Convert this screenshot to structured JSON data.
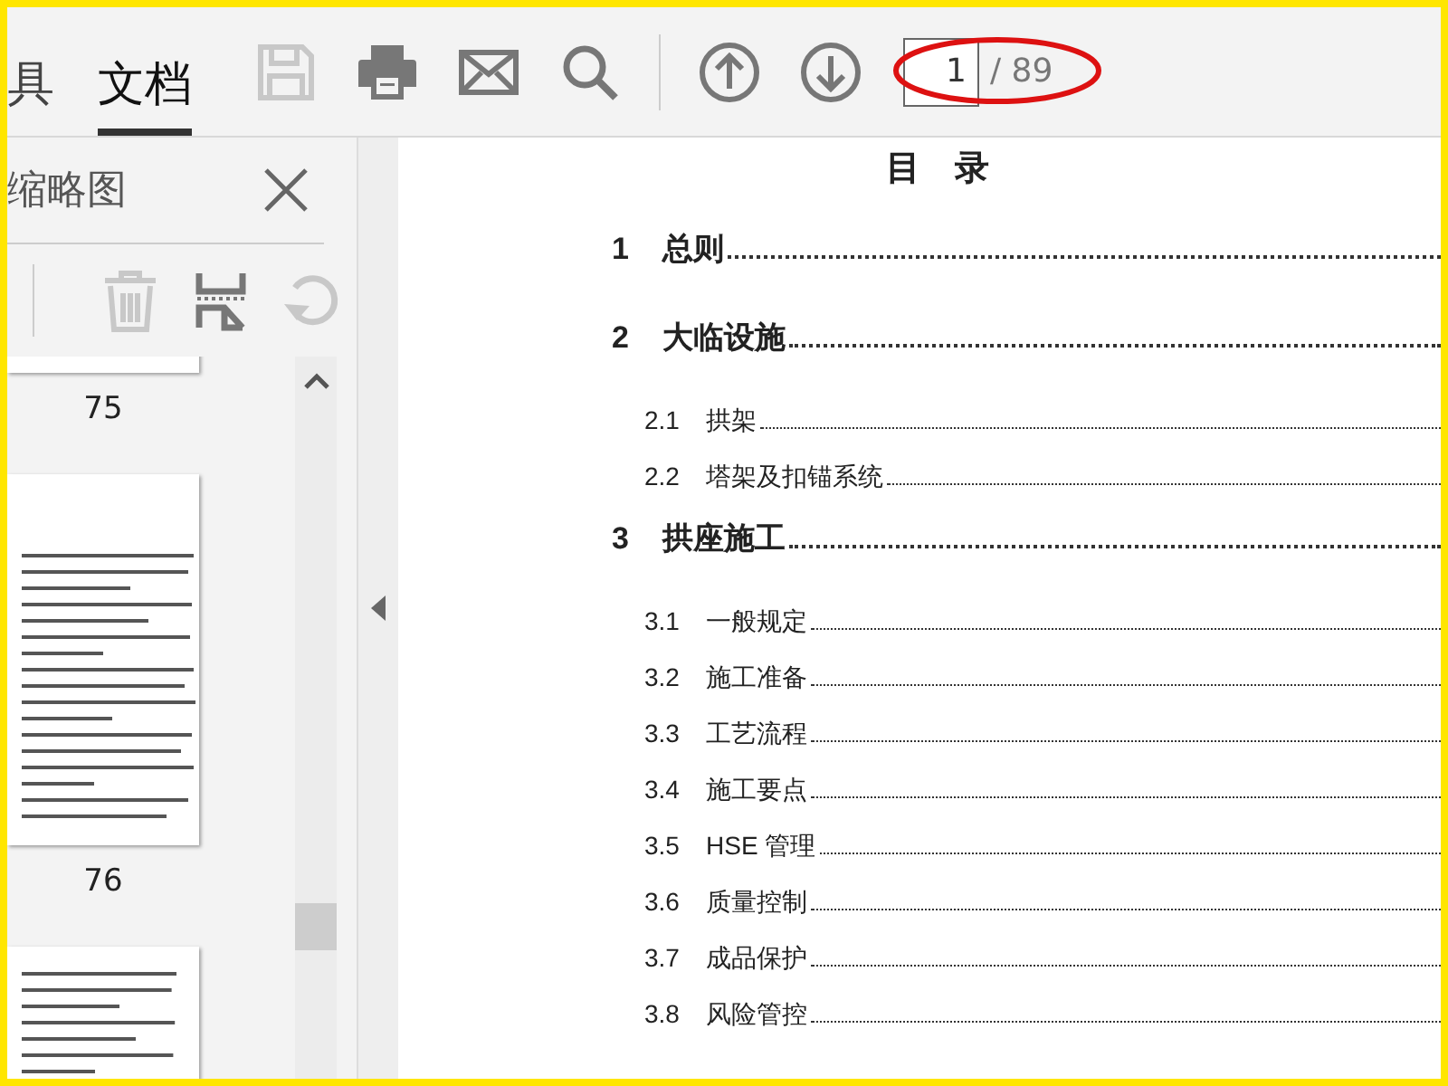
{
  "toolbar": {
    "tabs": [
      {
        "label": "具",
        "selected": false
      },
      {
        "label": "文档",
        "selected": true
      }
    ],
    "buttons": [
      {
        "kind": "save",
        "disabled": true
      },
      {
        "kind": "print",
        "disabled": false
      },
      {
        "kind": "mail",
        "disabled": false
      },
      {
        "kind": "search",
        "disabled": false
      }
    ],
    "nav": [
      {
        "kind": "up"
      },
      {
        "kind": "down"
      }
    ],
    "page_field": {
      "value": "1"
    },
    "page_total": "/ 89"
  },
  "sidebar": {
    "title": "缩略图",
    "tools": [
      {
        "kind": "trash",
        "disabled": true
      },
      {
        "kind": "split",
        "disabled": false
      },
      {
        "kind": "rotate",
        "disabled": true
      }
    ],
    "thumbnails": [
      {
        "label": "75"
      },
      {
        "label": "76"
      }
    ]
  },
  "document": {
    "heading": "目 录",
    "toc": [
      {
        "kind": "chapter",
        "number": "1",
        "title": "总则"
      },
      {
        "kind": "chapter",
        "number": "2",
        "title": "大临设施"
      },
      {
        "kind": "section",
        "number": "2.1",
        "title": "拱架"
      },
      {
        "kind": "section",
        "number": "2.2",
        "title": "塔架及扣锚系统"
      },
      {
        "kind": "chapter",
        "number": "3",
        "title": "拱座施工"
      },
      {
        "kind": "section",
        "number": "3.1",
        "title": "一般规定"
      },
      {
        "kind": "section",
        "number": "3.2",
        "title": "施工准备"
      },
      {
        "kind": "section",
        "number": "3.3",
        "title": "工艺流程"
      },
      {
        "kind": "section",
        "number": "3.4",
        "title": "施工要点"
      },
      {
        "kind": "section",
        "number": "3.5",
        "title": "HSE 管理"
      },
      {
        "kind": "section",
        "number": "3.6",
        "title": "质量控制"
      },
      {
        "kind": "section",
        "number": "3.7",
        "title": "成品保护"
      },
      {
        "kind": "section",
        "number": "3.8",
        "title": "风险管控"
      }
    ]
  }
}
